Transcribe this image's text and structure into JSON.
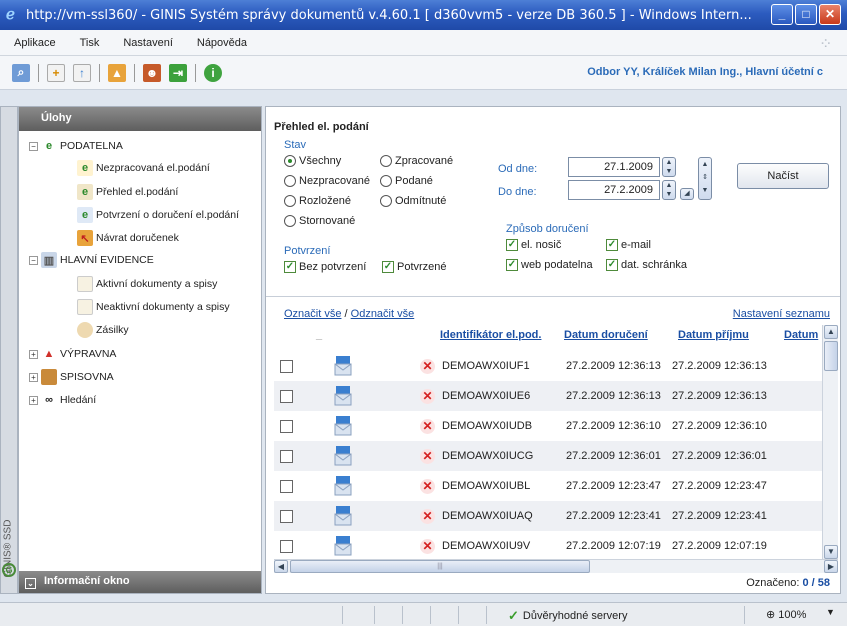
{
  "window": {
    "title": "http://vm-ssl360/ - GINIS Systém správy dokumentů v.4.60.1 [ d360vvm5 - verze DB 360.5 ] - Windows Intern..."
  },
  "menu": [
    "Aplikace",
    "Tisk",
    "Nastavení",
    "Nápověda"
  ],
  "user_info": "Odbor YY, Králíček Milan Ing., Hlavní účetní c",
  "toolbar_icons": [
    "search-doc-icon",
    "new-doc-icon",
    "doc-up-icon",
    "folder-up-icon",
    "users-icon",
    "exit-icon",
    "info-icon"
  ],
  "sidebar": {
    "title": "Úlohy",
    "vertical_label": "GINIS® SSD",
    "footer": "Informační okno",
    "tree": [
      {
        "label": "PODATELNA",
        "expander": "−"
      },
      {
        "label": "Nezpracovaná el.podání"
      },
      {
        "label": "Přehled el.podání"
      },
      {
        "label": "Potvrzení o doručení el.podání"
      },
      {
        "label": "Návrat doručenek"
      },
      {
        "label": "HLAVNÍ EVIDENCE",
        "expander": "−"
      },
      {
        "label": "Aktivní dokumenty a spisy"
      },
      {
        "label": "Neaktivní dokumenty a spisy"
      },
      {
        "label": "Zásilky"
      },
      {
        "label": "VÝPRAVNA",
        "expander": "+"
      },
      {
        "label": "SPISOVNA",
        "expander": "+"
      },
      {
        "label": "Hledání",
        "expander": "+"
      }
    ]
  },
  "filter": {
    "title": "Přehled el. podání",
    "state_label": "Stav",
    "states": [
      {
        "label": "Všechny",
        "checked": true
      },
      {
        "label": "Zpracované",
        "checked": false
      },
      {
        "label": "Nezpracované",
        "checked": false
      },
      {
        "label": "Podané",
        "checked": false
      },
      {
        "label": "Rozložené",
        "checked": false
      },
      {
        "label": "Odmítnuté",
        "checked": false
      },
      {
        "label": "Stornované",
        "checked": false
      }
    ],
    "confirm_label": "Potvrzení",
    "confirm": [
      {
        "label": "Bez potvrzení",
        "checked": true
      },
      {
        "label": "Potvrzené",
        "checked": true
      }
    ],
    "date_from_label": "Od dne:",
    "date_from": "27.1.2009",
    "date_to_label": "Do dne:",
    "date_to": "27.2.2009",
    "delivery_label": "Způsob doručení",
    "delivery": [
      {
        "label": "el. nosič",
        "checked": true
      },
      {
        "label": "e-mail",
        "checked": true
      },
      {
        "label": "web podatelna",
        "checked": true
      },
      {
        "label": "dat. schránka",
        "checked": true
      }
    ],
    "load_button": "Načíst"
  },
  "list": {
    "select_all": "Označit vše",
    "separator": " / ",
    "deselect_all": "Odznačit vše",
    "settings": "Nastavení seznamu",
    "columns": [
      "Identifikátor el.pod.",
      "Datum doručení",
      "Datum příjmu",
      "Datum"
    ],
    "rows": [
      {
        "id": "DEMOAWX0IUF1",
        "delivered": "27.2.2009 12:36:13",
        "received": "27.2.2009 12:36:13"
      },
      {
        "id": "DEMOAWX0IUE6",
        "delivered": "27.2.2009 12:36:13",
        "received": "27.2.2009 12:36:13"
      },
      {
        "id": "DEMOAWX0IUDB",
        "delivered": "27.2.2009 12:36:10",
        "received": "27.2.2009 12:36:10"
      },
      {
        "id": "DEMOAWX0IUCG",
        "delivered": "27.2.2009 12:36:01",
        "received": "27.2.2009 12:36:01"
      },
      {
        "id": "DEMOAWX0IUBL",
        "delivered": "27.2.2009 12:23:47",
        "received": "27.2.2009 12:23:47"
      },
      {
        "id": "DEMOAWX0IUAQ",
        "delivered": "27.2.2009 12:23:41",
        "received": "27.2.2009 12:23:41"
      },
      {
        "id": "DEMOAWX0IU9V",
        "delivered": "27.2.2009 12:07:19",
        "received": "27.2.2009 12:07:19"
      }
    ],
    "marked_label": "Označeno:",
    "marked_count": "0",
    "total_count": "58"
  },
  "statusbar": {
    "trusted": "Důvěryhodné servery",
    "zoom": "100%"
  }
}
